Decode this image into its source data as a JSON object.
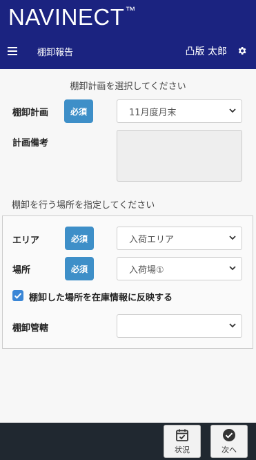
{
  "header": {
    "brand": "NAVINECT",
    "brand_tm": "™",
    "title": "棚卸報告",
    "user": "凸版 太郎",
    "color": "#1b2380"
  },
  "plan_section": {
    "hint": "棚卸計画を選択してください",
    "plan_label": "棚卸計画",
    "required_badge": "必須",
    "plan_value": "11月度月末",
    "note_label": "計画備考",
    "note_value": ""
  },
  "location_section": {
    "hint": "棚卸を行う場所を指定してください",
    "area_label": "エリア",
    "area_badge": "必須",
    "area_value": "入荷エリア",
    "place_label": "場所",
    "place_badge": "必須",
    "place_value": "入荷場①",
    "reflect_checkbox": {
      "label": "棚卸した場所を在庫情報に反映する",
      "checked": true
    },
    "jurisdiction_label": "棚卸管轄",
    "jurisdiction_value": ""
  },
  "footer": {
    "status_label": "状況",
    "next_label": "次へ"
  },
  "icons": {
    "menu": "menu-icon",
    "settings": "gear-icon",
    "status": "calendar-check-icon",
    "next": "check-circle-icon",
    "dropdown": "chevron-down-icon"
  },
  "colors": {
    "badge": "#3e8fc8",
    "checkbox": "#3a86d6",
    "footer": "#202830"
  }
}
